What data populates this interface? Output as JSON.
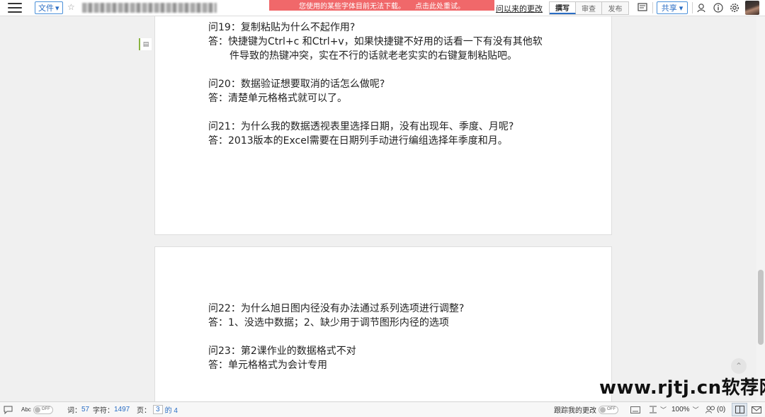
{
  "toolbar": {
    "file_label": "文件",
    "file_chevron": "▾",
    "banner_text": "您使用的某些字体目前无法下载。",
    "banner_link": "点击此处重试。",
    "since_changes": "问以来的更改",
    "mode_tabs": [
      "撰写",
      "审查",
      "发布"
    ],
    "share_label": "共享",
    "share_chevron": "▾",
    "icons": [
      "menu-icon",
      "star-icon",
      "comment-panel-icon",
      "search-user-icon",
      "info-icon",
      "gear-icon"
    ]
  },
  "page1": {
    "margin_mark": "▤",
    "lines": [
      "问19：复制粘贴为什么不起作用?",
      "答：快捷键为Ctrl+c 和Ctrl+v，如果快捷键不好用的话看一下有没有其他软",
      "件导致的热键冲突，实在不行的话就老老实实的右键复制粘贴吧。",
      "",
      "问20：数据验证想要取消的话怎么做呢?",
      "答：清楚单元格格式就可以了。",
      "",
      "问21：为什么我的数据透视表里选择日期，没有出现年、季度、月呢?",
      "答：2013版本的Excel需要在日期列手动进行编组选择年季度和月。"
    ]
  },
  "page2": {
    "lines": [
      "问22：为什么旭日图内径没有办法通过系列选项进行调整?",
      "答：1、没选中数据；2、缺少用于调节图形内径的选项",
      "",
      "问23：第2课作业的数据格式不对",
      "答：单元格格式为会计专用"
    ]
  },
  "watermark": "www.rjtj.cn软荐网",
  "status": {
    "spell_label": "Abc",
    "spell_toggle": "OFF",
    "words_label": "词：",
    "words_value": "57",
    "chars_label": "字符：",
    "chars_value": "1497",
    "page_label": "页：",
    "page_current": "3",
    "page_of": "的 4",
    "track_label": "跟踪我的更改",
    "track_toggle": "OFF",
    "zoom": "100%",
    "coauthors": "(0)",
    "colors": {
      "accent": "#2a6dc4",
      "banner": "#f0686a",
      "margin_mark": "#8ab441"
    }
  }
}
